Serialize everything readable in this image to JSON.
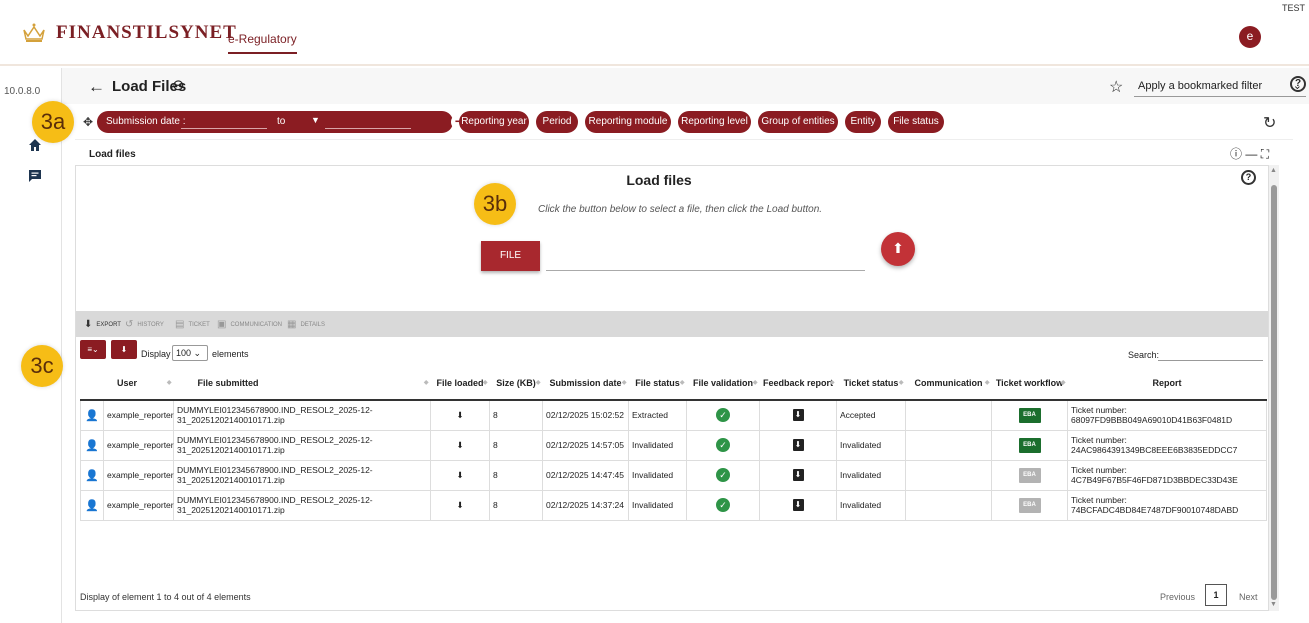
{
  "header": {
    "brand": "FINANSTILSYNET",
    "app_link": "e-Regulatory",
    "test_tag": "TEST",
    "avatar_letter": "e"
  },
  "sidebar": {
    "version": "10.0.8.0",
    "icons": [
      "home-icon",
      "chat-icon"
    ]
  },
  "page": {
    "title": "Load Files",
    "bookmark_filter": "Apply a bookmarked filter"
  },
  "filters": {
    "submission_date_label": "Submission date :",
    "to_label": "to",
    "pills": [
      "Reporting year",
      "Period",
      "Reporting module",
      "Reporting level",
      "Group of entities",
      "Entity",
      "File status"
    ]
  },
  "section": {
    "title": "Load files",
    "panel_title": "Load files",
    "hint": "Click the button below to select a file, then click the Load button.",
    "file_button": "FILE"
  },
  "toolbar": {
    "items": [
      "EXPORT",
      "HISTORY",
      "TICKET",
      "COMMUNICATION",
      "DETAILS"
    ]
  },
  "table": {
    "display_label": "Display",
    "display_value": "100",
    "elements_label": "elements",
    "search_label": "Search:",
    "columns": [
      "User",
      "File submitted",
      "File loaded",
      "Size (KB)",
      "Submission date",
      "File status",
      "File validation",
      "Feedback report",
      "Ticket status",
      "Communication",
      "Ticket workflow",
      "Report"
    ],
    "rows": [
      {
        "user": "example_reporter",
        "file_line1": "DUMMYLEI012345678900.IND_RESOL2_2025-12-",
        "file_line2": "31_20251202140010171.zip",
        "size": "8",
        "date": "02/12/2025 15:02:52",
        "status": "Extracted",
        "ticket_status": "Accepted",
        "workflow": "EBA",
        "ticket_label": "Ticket number:",
        "ticket_no": "68097FD9BBB049A69010D41B63F0481D"
      },
      {
        "user": "example_reporter",
        "file_line1": "DUMMYLEI012345678900.IND_RESOL2_2025-12-",
        "file_line2": "31_20251202140010171.zip",
        "size": "8",
        "date": "02/12/2025 14:57:05",
        "status": "Invalidated",
        "ticket_status": "Invalidated",
        "workflow": "EBA",
        "ticket_label": "Ticket number:",
        "ticket_no": "24AC9864391349BC8EEE6B3835EDDCC7"
      },
      {
        "user": "example_reporter",
        "file_line1": "DUMMYLEI012345678900.IND_RESOL2_2025-12-",
        "file_line2": "31_20251202140010171.zip",
        "size": "8",
        "date": "02/12/2025 14:47:45",
        "status": "Invalidated",
        "ticket_status": "Invalidated",
        "workflow": "EBA",
        "ticket_label": "Ticket number:",
        "ticket_no": "4C7B49F67B5F46FD871D3BBDEC33D43E"
      },
      {
        "user": "example_reporter",
        "file_line1": "DUMMYLEI012345678900.IND_RESOL2_2025-12-",
        "file_line2": "31_20251202140010171.zip",
        "size": "8",
        "date": "02/12/2025 14:37:24",
        "status": "Invalidated",
        "ticket_status": "Invalidated",
        "workflow": "EBA",
        "ticket_label": "Ticket number:",
        "ticket_no": "74BCFADC4BD84E7487DF90010748DABD"
      }
    ]
  },
  "footer": {
    "info": "Display of element 1 to 4 out of 4 elements",
    "previous": "Previous",
    "page": "1",
    "next": "Next"
  },
  "callouts": [
    "3a",
    "3b",
    "3c"
  ],
  "colors": {
    "brand": "#7b1f24",
    "pill": "#8b1c22",
    "accent_yellow": "#f6bd16",
    "ok_green": "#2e8b3d",
    "error_red": "#c0272d"
  }
}
